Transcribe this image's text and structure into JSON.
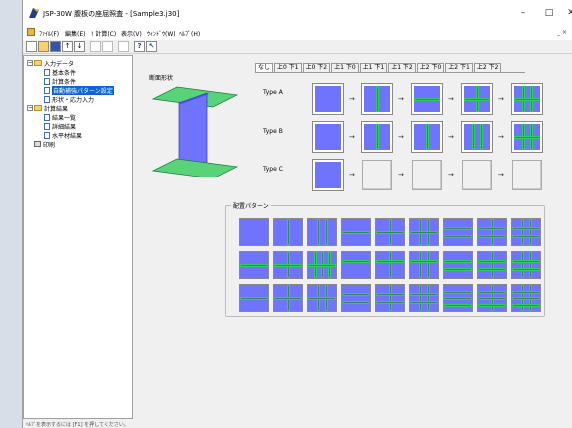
{
  "window": {
    "title": "JSP-30W  腹板の座屈照査 - [Sample3.j30]",
    "minimize": "–",
    "maximize": "□",
    "close": "✕"
  },
  "menu": [
    "ﾌｧｲﾙ(F)",
    "編集(E)",
    "! 計算(C)",
    "表示(V)",
    "ｳｨﾝﾄﾞｳ(W)",
    "ﾍﾙﾌﾟ(H)"
  ],
  "mdi_controls": "_ ×",
  "tree": {
    "input": "入力データ",
    "basic": "基本条件",
    "calc_cond": "計算条件",
    "auto_pattern": "自動補強パターン設定",
    "shape": "形状・応力入力",
    "results": "計算結果",
    "results_list": "結果一覧",
    "detail": "詳細結果",
    "horizontal": "水平材結果",
    "print": "印刷"
  },
  "content": {
    "cross_section_label": "断面形状",
    "tabs": [
      "なし",
      "上0 下1",
      "上0 下2",
      "上1 下0",
      "上1 下1",
      "上1 下2",
      "上2 下0",
      "上2 下1",
      "上2 下2"
    ],
    "types": [
      "Type A",
      "Type B",
      "Type C"
    ],
    "arrow": "→",
    "pattern_label": "配置パターン"
  },
  "status": "ﾍﾙﾌﾟを表示するには [F1] を押してください。",
  "colors": {
    "panel_fill": "#6f74ff",
    "stiffener": "#2e8b57",
    "flange": "#58d37a"
  }
}
